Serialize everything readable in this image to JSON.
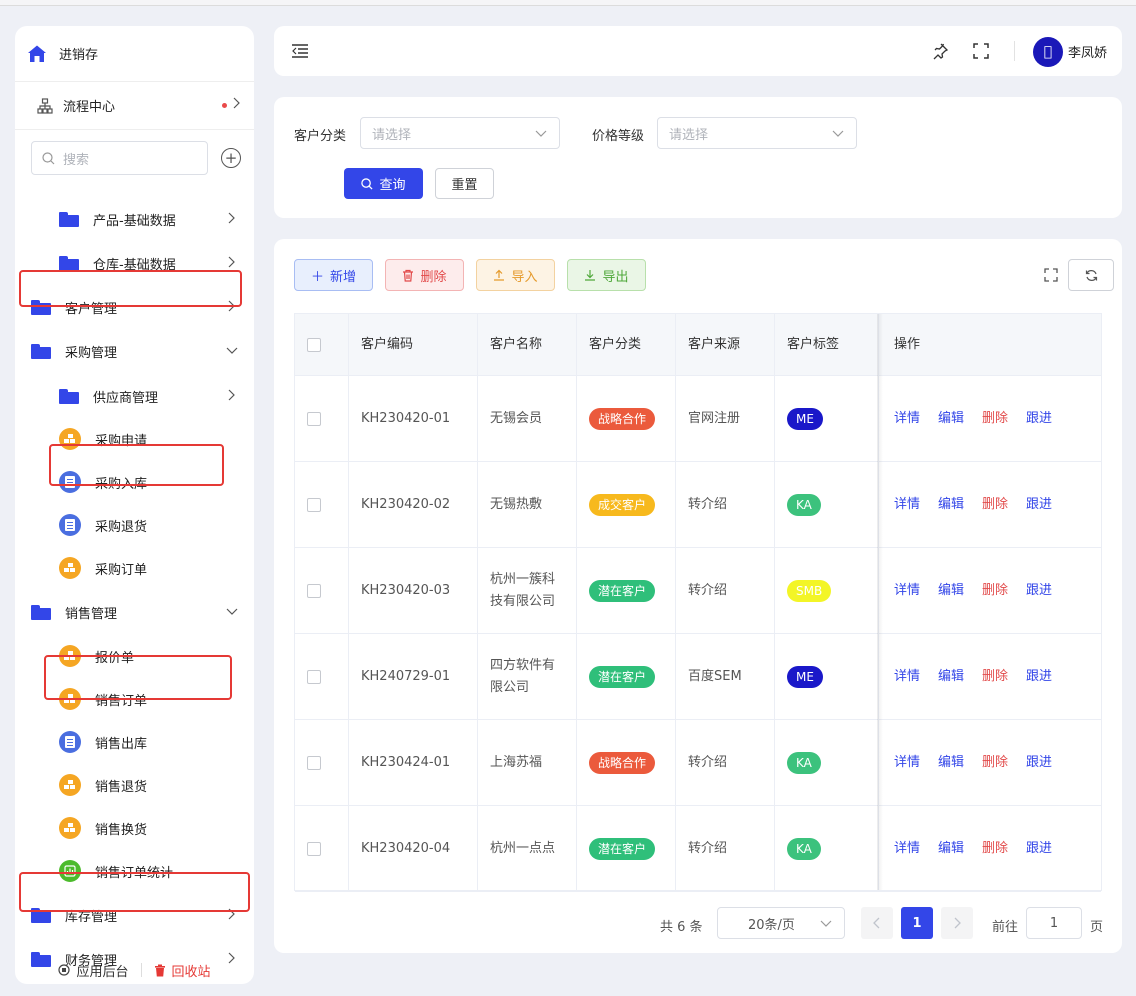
{
  "sidebar": {
    "brand": "进销存",
    "flow_center": "流程中心",
    "search_placeholder": "搜索",
    "items": [
      {
        "label": "产品-基础数据",
        "level": 2,
        "icon": "folder-icon",
        "chevron": "right"
      },
      {
        "label": "仓库-基础数据",
        "level": 2,
        "icon": "folder-icon",
        "chevron": "right"
      },
      {
        "label": "客户管理",
        "level": 1,
        "icon": "folder-icon",
        "chevron": "right"
      },
      {
        "label": "采购管理",
        "level": 1,
        "icon": "folder-icon",
        "chevron": "down"
      },
      {
        "label": "供应商管理",
        "level": 2,
        "icon": "folder-icon",
        "chevron": "right"
      },
      {
        "label": "采购申请",
        "level": 2,
        "icon": "boxes-icon"
      },
      {
        "label": "采购入库",
        "level": 2,
        "icon": "document-icon"
      },
      {
        "label": "采购退货",
        "level": 2,
        "icon": "document-icon"
      },
      {
        "label": "采购订单",
        "level": 2,
        "icon": "boxes-icon"
      },
      {
        "label": "销售管理",
        "level": 1,
        "icon": "folder-icon",
        "chevron": "down"
      },
      {
        "label": "报价单",
        "level": 2,
        "icon": "boxes-icon"
      },
      {
        "label": "销售订单",
        "level": 2,
        "icon": "boxes-icon"
      },
      {
        "label": "销售出库",
        "level": 2,
        "icon": "document-icon"
      },
      {
        "label": "销售退货",
        "level": 2,
        "icon": "boxes-icon"
      },
      {
        "label": "销售换货",
        "level": 2,
        "icon": "boxes-icon"
      },
      {
        "label": "销售订单统计",
        "level": 2,
        "icon": "chart-icon"
      },
      {
        "label": "库存管理",
        "level": 1,
        "icon": "folder-icon",
        "chevron": "right"
      },
      {
        "label": "财务管理",
        "level": 1,
        "icon": "folder-icon",
        "chevron": "right"
      }
    ],
    "footer": {
      "admin": "应用后台",
      "trash": "回收站"
    }
  },
  "header": {
    "user_name": "李凤娇",
    "avatar_glyph": "󰀀"
  },
  "filter": {
    "category_label": "客户分类",
    "category_placeholder": "请选择",
    "price_label": "价格等级",
    "price_placeholder": "请选择",
    "query_button": "查询",
    "reset_button": "重置"
  },
  "toolbar": {
    "add": "新增",
    "delete": "删除",
    "import": "导入",
    "export": "导出"
  },
  "table": {
    "columns": [
      "客户编码",
      "客户名称",
      "客户分类",
      "客户来源",
      "客户标签",
      "操作"
    ],
    "rows": [
      {
        "code": "KH230420-01",
        "name_lines": [
          "无锡会员"
        ],
        "category": "战略合作",
        "category_color": "#eb5a3c",
        "source": "官网注册",
        "tag": "ME",
        "tag_color": "#1a18c9"
      },
      {
        "code": "KH230420-02",
        "name_lines": [
          "无锡热敷"
        ],
        "category": "成交客户",
        "category_color": "#f7b91d",
        "source": "转介绍",
        "tag": "KA",
        "tag_color": "#3cc27d"
      },
      {
        "code": "KH230420-03",
        "name_lines": [
          "杭州一簇科",
          "技有限公司"
        ],
        "category": "潜在客户",
        "category_color": "#2fbf7a",
        "source": "转介绍",
        "tag": "SMB",
        "tag_color": "#f3f527"
      },
      {
        "code": "KH240729-01",
        "name_lines": [
          "四方软件有",
          "限公司"
        ],
        "category": "潜在客户",
        "category_color": "#2fbf7a",
        "source": "百度SEM",
        "tag": "ME",
        "tag_color": "#1a18c9"
      },
      {
        "code": "KH230424-01",
        "name_lines": [
          "上海苏福"
        ],
        "category": "战略合作",
        "category_color": "#eb5a3c",
        "source": "转介绍",
        "tag": "KA",
        "tag_color": "#3cc27d"
      },
      {
        "code": "KH230420-04",
        "name_lines": [
          "杭州一点点"
        ],
        "category": "潜在客户",
        "category_color": "#2fbf7a",
        "source": "转介绍",
        "tag": "KA",
        "tag_color": "#3cc27d"
      }
    ],
    "actions": {
      "detail": "详情",
      "edit": "编辑",
      "delete": "删除",
      "follow": "跟进"
    }
  },
  "pagination": {
    "total": "共 6 条",
    "page_size": "20条/页",
    "current_page": "1",
    "goto_label": "前往",
    "goto_value": "1",
    "page_suffix": "页"
  }
}
